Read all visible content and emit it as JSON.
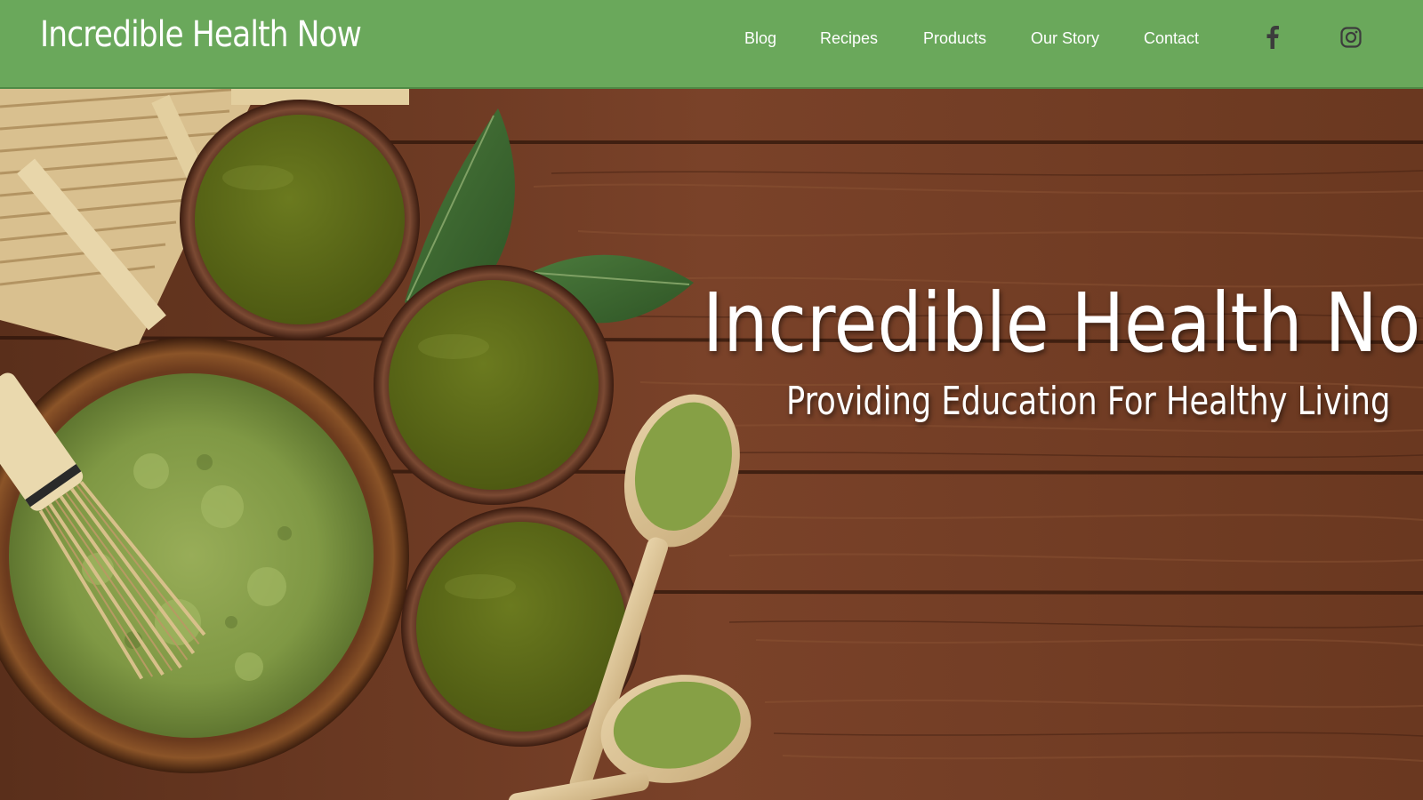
{
  "header": {
    "site_title": "Incredible Health Now",
    "background_color": "#6aa85b",
    "nav": [
      {
        "label": "Blog"
      },
      {
        "label": "Recipes"
      },
      {
        "label": "Products"
      },
      {
        "label": "Our Story"
      },
      {
        "label": "Contact"
      }
    ],
    "social": [
      {
        "icon": "facebook-icon"
      },
      {
        "icon": "instagram-icon"
      }
    ]
  },
  "hero": {
    "title": "Incredible Health Now",
    "subtitle": "Providing Education For Healthy Living",
    "image_description_icon": "matcha-tea-photo"
  },
  "colors": {
    "accent_green": "#6aa85b",
    "wood_brown": "#6b3d25",
    "matcha": "#5c6b1a"
  }
}
